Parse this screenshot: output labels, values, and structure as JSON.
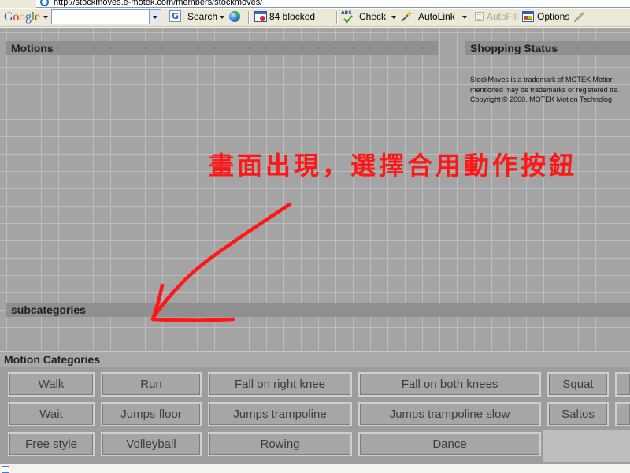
{
  "browser": {
    "url": "http://stockmoves.e-motek.com/members/stockmoves/"
  },
  "toolbar": {
    "logo": "Google",
    "logo_colors": [
      "#2f62c8",
      "#d92b1f",
      "#e8a900",
      "#2f62c8",
      "#1f9a2c",
      "#d92b1f"
    ],
    "search_icon_text": "G",
    "search_label": "Search",
    "popup_blocked_label": "84 blocked",
    "spell_icon_text": "ABC",
    "check_label": "Check",
    "autolink_label": "AutoLink",
    "autofill_label": "AutoFill",
    "options_label": "Options"
  },
  "page": {
    "motions_heading": "Motions",
    "shopping_heading": "Shopping Status",
    "shopping_lines": [
      "StockMoves is a trademark of MOTEK Motion",
      "mentioned may be trademarks or registered tra",
      "Copyright © 2000. MOTEK Motion Technolog"
    ],
    "subcategories_heading": "subcategories",
    "categories_heading": "Motion Categories",
    "categories": [
      [
        "Walk",
        "Run",
        "Fall on right knee",
        "Fall on both knees",
        "Squat"
      ],
      [
        "Wait",
        "Jumps floor",
        "Jumps trampoline",
        "Jumps trampoline slow",
        "Saltos"
      ],
      [
        "Free style",
        "Volleyball",
        "Rowing",
        "Dance"
      ]
    ]
  },
  "annotation": {
    "text": "畫面出現，選擇合用動作按鈕"
  },
  "icons": [
    "ie-page-icon",
    "dropdown-arrow-icon",
    "google-search-icon",
    "globe-icon",
    "popup-blocker-icon",
    "spell-check-icon",
    "autolink-wand-icon",
    "autofill-icon",
    "options-icon",
    "highlighter-icon"
  ],
  "colors": {
    "page_background": "#a4a4a4",
    "grid_line": "#bdbdbd",
    "heading_bar": "#8f8f8f",
    "annotation_red": "#ff1616",
    "toolbar_background": "#ece9d8",
    "button_face": "#a6a6a6",
    "button_text": "#3d3d3d"
  }
}
